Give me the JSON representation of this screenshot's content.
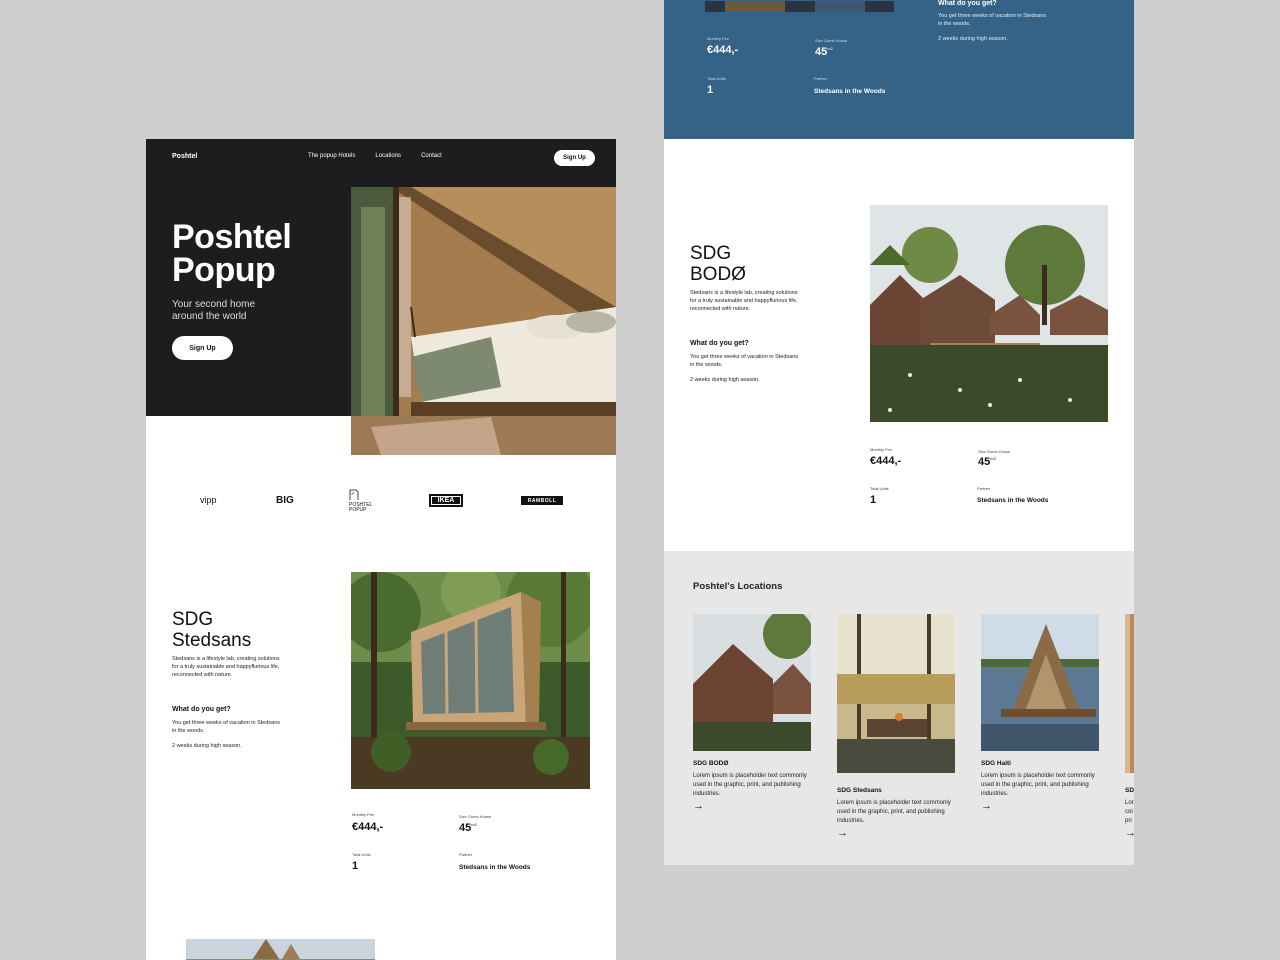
{
  "left_page": {
    "nav": {
      "logo": "Poshtel",
      "links": [
        "The popup Hotels",
        "Locations",
        "Contact"
      ],
      "signup": "Sign Up"
    },
    "hero": {
      "title_line1": "Poshtel",
      "title_line2": "Popup",
      "subtitle_line1": "Your second home",
      "subtitle_line2": "around the world",
      "cta": "Sign Up"
    },
    "partners": {
      "vipp": "vipp",
      "big": "BIG",
      "poshtel_line1": "POSHTEL",
      "poshtel_line2": "POPUP",
      "ikea": "IKEA",
      "ramboll": "RAMBOLL"
    },
    "property": {
      "title_line1": "SDG",
      "title_line2": "Stedsans",
      "description": "Stedsans is a lifestyle lab, creating solutions for a truly sustainable and happyflurious life, reconnected with nature.",
      "question": "What do you get?",
      "answer": "You get three weeks of vacation in Stedsans in the woods.",
      "note": "2 weeks during high season.",
      "stats": {
        "monthly_fee_label": "Monthly Fee",
        "monthly_fee": "€444,-",
        "size_label": "Size Guest House",
        "size": "45",
        "size_unit": "m2",
        "units_label": "Total Units",
        "units": "1",
        "partner_label": "Partner",
        "partner": "Stedsans in the Woods"
      }
    }
  },
  "right_page": {
    "top_section": {
      "question": "What do you get?",
      "answer": "You get three weeks of vacation in Stedsans in the woods.",
      "note": "2 weeks during high season.",
      "stats": {
        "monthly_fee_label": "Monthly Fee",
        "monthly_fee": "€444,-",
        "size_label": "Size Guest House",
        "size": "45",
        "size_unit": "m2",
        "units_label": "Total Units",
        "units": "1",
        "partner_label": "Partner",
        "partner": "Stedsans in the Woods"
      }
    },
    "property": {
      "title_line1": "SDG",
      "title_line2": "BODØ",
      "description": "Stedsans is a lifestyle lab, creating solutions for a truly sustainable and happyflurious life, reconnected with nature.",
      "question": "What do you get?",
      "answer": "You get three weeks of vacation in Stedsans in the woods.",
      "note": "2 weeks during high season.",
      "stats": {
        "monthly_fee_label": "Monthly Fee",
        "monthly_fee": "€444,-",
        "size_label": "Size Guest House",
        "size": "45",
        "size_unit": "m2",
        "units_label": "Total Units",
        "units": "1",
        "partner_label": "Partner",
        "partner": "Stedsans in the Woods"
      }
    },
    "locations": {
      "title": "Poshtel's Locations",
      "items": [
        {
          "name": "SDG BODØ",
          "text": "Lorem ipsum is placeholder text commonly used in the graphic, print, and publishing industries."
        },
        {
          "name": "SDG Stedsans",
          "text": "Lorem ipsum is placeholder text commonly used in the graphic, print, and publishing industries."
        },
        {
          "name": "SDG Haiti",
          "text": "Lorem ipsum is placeholder text commonly used in the graphic, print, and publishing industries."
        },
        {
          "name": "SD",
          "text": "Lor coi pri"
        }
      ],
      "arrow": "→"
    }
  }
}
